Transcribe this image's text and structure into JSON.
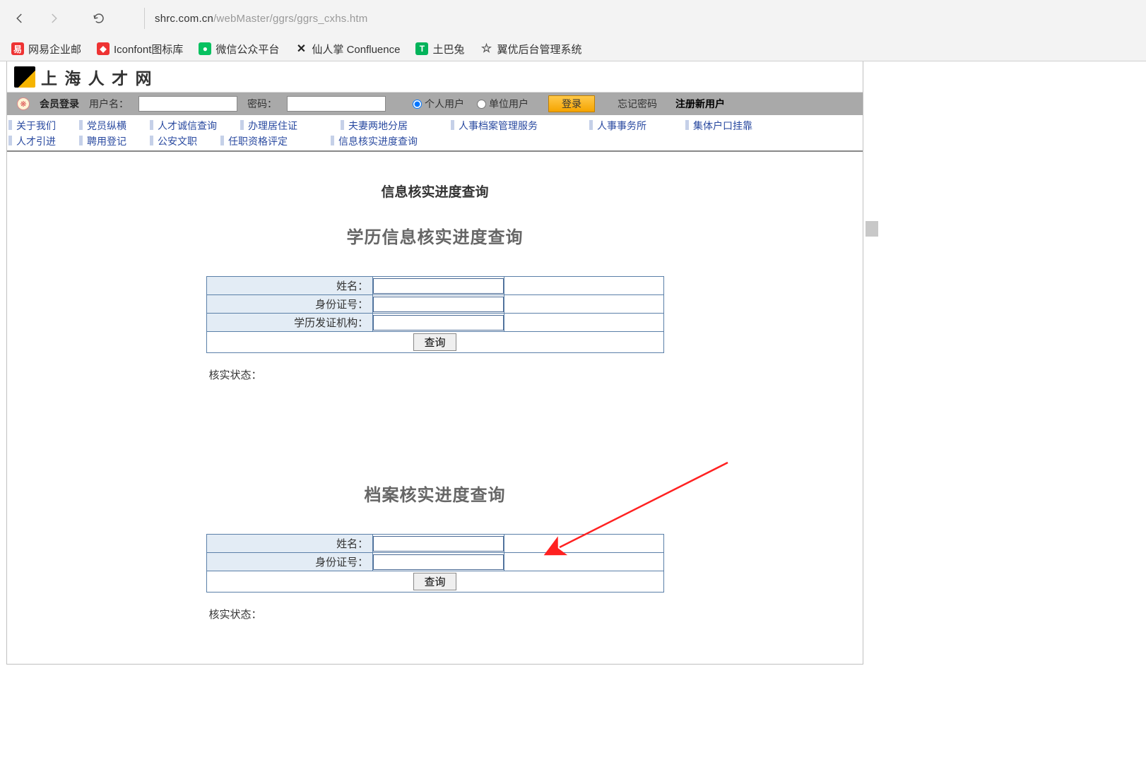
{
  "browser": {
    "url_host": "shrc.com.cn",
    "url_path": "/webMaster/ggrs/ggrs_cxhs.htm"
  },
  "bookmarks": [
    {
      "label": "网易企业邮",
      "color": "#e33"
    },
    {
      "label": "Iconfont图标库",
      "color": "#e33"
    },
    {
      "label": "微信公众平台",
      "color": "#07c160"
    },
    {
      "label": "仙人掌 Confluence",
      "color": "#222"
    },
    {
      "label": "土巴兔",
      "color": "#02b35a"
    },
    {
      "label": "翼优后台管理系统",
      "color": "transparent"
    }
  ],
  "site": {
    "title": "上 海 人 才 网"
  },
  "login": {
    "title": "会员登录",
    "username_label": "用户名：",
    "password_label": "密码：",
    "radio_personal": "个人用户",
    "radio_company": "单位用户",
    "btn_login": "登录",
    "forgot": "忘记密码",
    "register": "注册新用户"
  },
  "nav": {
    "row1": [
      "关于我们",
      "党员纵横",
      "人才诚信查询",
      "办理居住证",
      "夫妻两地分居",
      "人事档案管理服务",
      "人事事务所",
      "集体户口挂靠"
    ],
    "row2": [
      "人才引进",
      "聘用登记",
      "公安文职",
      "任职资格评定",
      "信息核实进度查询"
    ]
  },
  "page_title": "信息核实进度查询",
  "section1": {
    "title": "学历信息核实进度查询",
    "fields": {
      "name": "姓名：",
      "id": "身份证号：",
      "org": "学历发证机构："
    },
    "btn_query": "查询",
    "status_label": "核实状态："
  },
  "section2": {
    "title": "档案核实进度查询",
    "fields": {
      "name": "姓名：",
      "id": "身份证号："
    },
    "btn_query": "查询",
    "status_label": "核实状态："
  }
}
